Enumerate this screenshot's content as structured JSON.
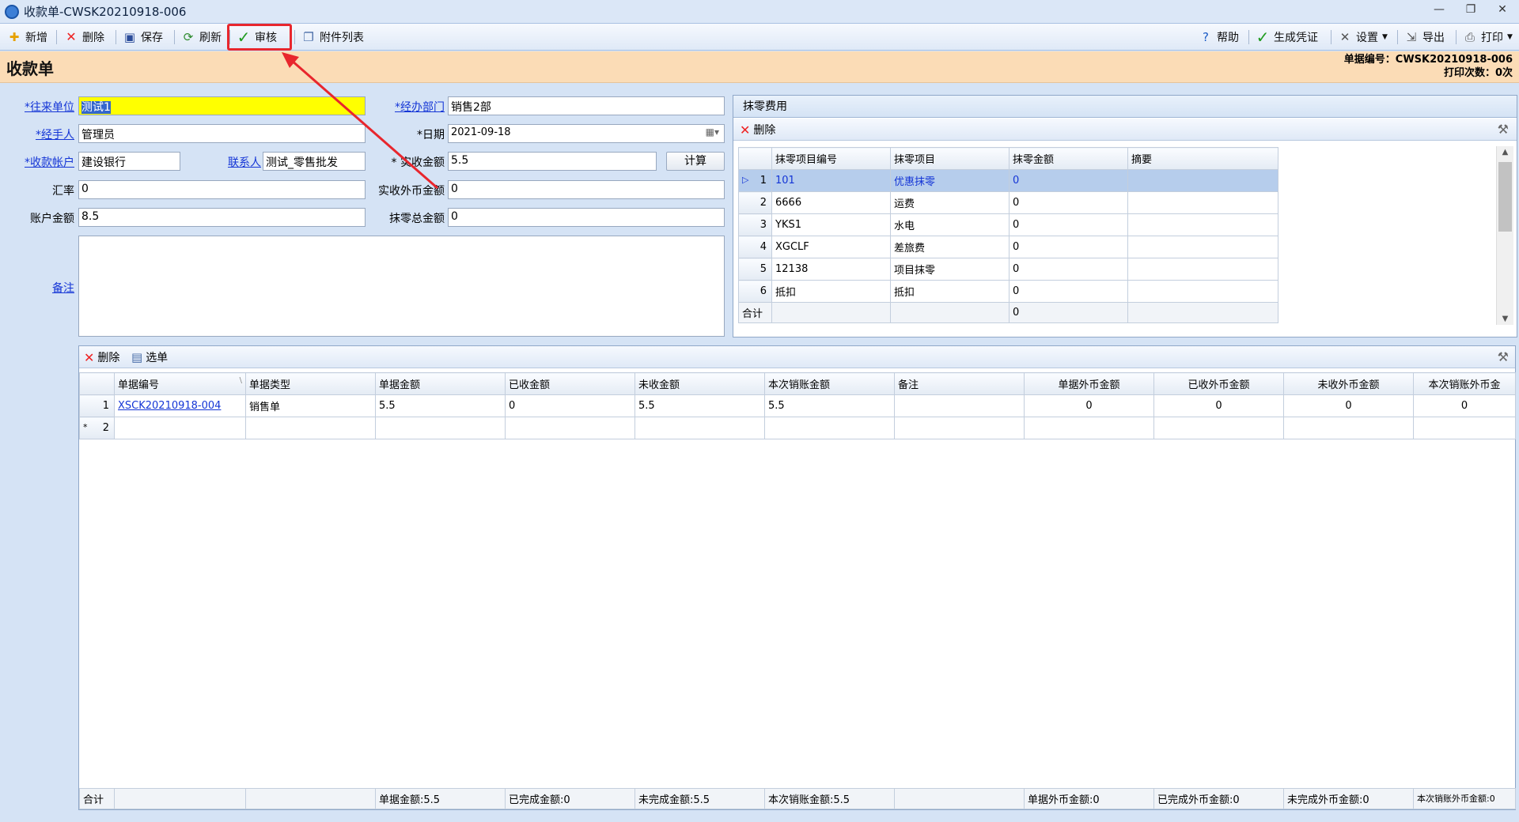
{
  "window": {
    "title": "收款单-CWSK20210918-006",
    "controls": [
      "—",
      "❐",
      "✕"
    ]
  },
  "toolbar": {
    "new": "新增",
    "delete": "删除",
    "save": "保存",
    "refresh": "刷新",
    "audit": "审核",
    "attachments": "附件列表",
    "help": "帮助",
    "voucher": "生成凭证",
    "settings": "设置",
    "export": "导出",
    "print": "打印"
  },
  "header": {
    "title": "收款单",
    "doc_no": "单据编号：CWSK20210918-006",
    "print_count": "打印次数：0次"
  },
  "form": {
    "customer_label": "*往来单位",
    "customer_value": "测试1",
    "handler_label": "*经手人",
    "handler_value": "管理员",
    "account_label": "*收款帐户",
    "account_value": "建设银行",
    "contact_label": "联系人",
    "contact_value": "测试_零售批发",
    "rate_label": "汇率",
    "rate_value": "0",
    "acc_amount_label": "账户金额",
    "acc_amount_value": "8.5",
    "dept_label": "*经办部门",
    "dept_value": "销售2部",
    "date_label": "*日期",
    "date_value": "2021-09-18",
    "received_label": "* 实收金额",
    "received_value": "5.5",
    "calc_button": "计算",
    "foreign_label": "实收外币金额",
    "foreign_value": "0",
    "writeoff_total_label": "抹零总金额",
    "writeoff_total_value": "0",
    "remark_label": "备注",
    "remark_value": ""
  },
  "writeoff_panel": {
    "title": "抹零费用",
    "delete": "删除",
    "columns": [
      "抹零项目编号",
      "抹零项目",
      "抹零金额",
      "摘要"
    ],
    "rows": [
      {
        "no": "1",
        "code": "101",
        "name": "优惠抹零",
        "amount": "0",
        "note": ""
      },
      {
        "no": "2",
        "code": "6666",
        "name": "运费",
        "amount": "0",
        "note": ""
      },
      {
        "no": "3",
        "code": "YKS1",
        "name": "水电",
        "amount": "0",
        "note": ""
      },
      {
        "no": "4",
        "code": "XGCLF",
        "name": "差旅费",
        "amount": "0",
        "note": ""
      },
      {
        "no": "5",
        "code": "12138",
        "name": "项目抹零",
        "amount": "0",
        "note": ""
      },
      {
        "no": "6",
        "code": "抵扣",
        "name": "抵扣",
        "amount": "0",
        "note": ""
      }
    ],
    "total_label": "合计",
    "total_amount": "0"
  },
  "detail_grid": {
    "delete": "删除",
    "select": "选单",
    "columns": [
      "单据编号",
      "单据类型",
      "单据金额",
      "已收金额",
      "未收金额",
      "本次销账金额",
      "备注",
      "单据外币金额",
      "已收外币金额",
      "未收外币金额",
      "本次销账外币金"
    ],
    "rows": [
      {
        "no": "1",
        "doc": "XSCK20210918-004",
        "type": "销售单",
        "amount": "5.5",
        "received": "0",
        "unreceived": "5.5",
        "writeoff": "5.5",
        "remark": "",
        "f_amount": "0",
        "f_received": "0",
        "f_unreceived": "0",
        "f_writeoff": "0"
      },
      {
        "no": "2",
        "doc": "",
        "type": "",
        "amount": "",
        "received": "",
        "unreceived": "",
        "writeoff": "",
        "remark": "",
        "f_amount": "",
        "f_received": "",
        "f_unreceived": "",
        "f_writeoff": ""
      }
    ],
    "new_row_marker": "*",
    "footer": {
      "label": "合计",
      "amount": "单据金额:5.5",
      "completed": "已完成金额:0",
      "uncompleted": "未完成金额:5.5",
      "writeoff": "本次销账金额:5.5",
      "f_amount": "单据外币金额:0",
      "f_completed": "已完成外币金额:0",
      "f_uncompleted": "未完成外币金额:0",
      "f_writeoff": "本次销账外币金额:0"
    }
  },
  "colors": {
    "highlight": "#e8262d",
    "header_band": "#fbdcb6",
    "link": "#1435d6"
  }
}
